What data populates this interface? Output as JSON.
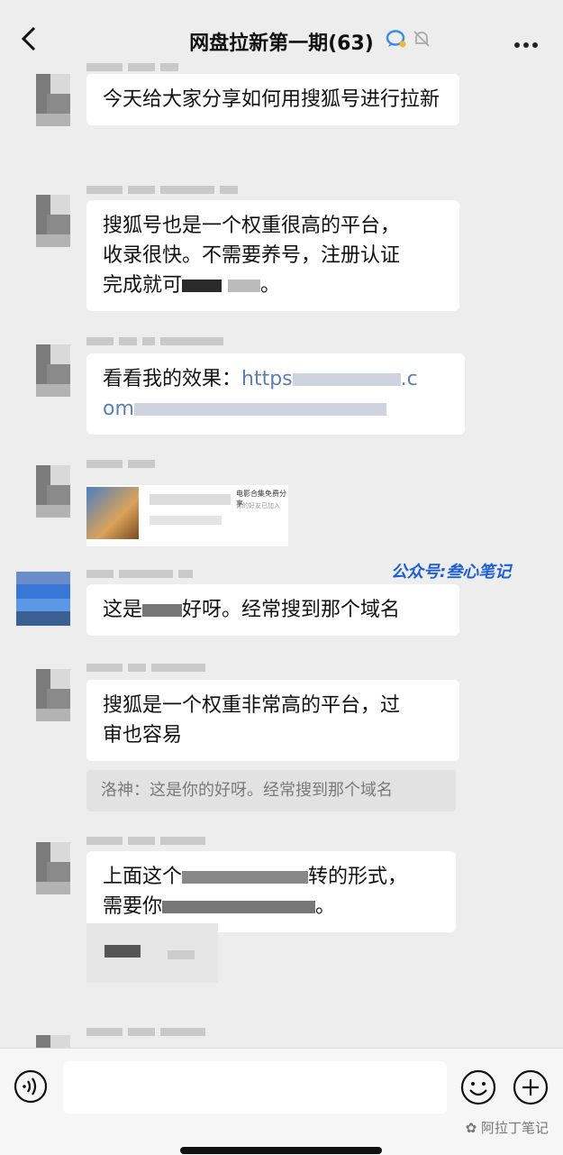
{
  "header": {
    "title": "网盘拉新第一期(63)"
  },
  "messages": [
    {
      "text": "今天给大家分享如何用搜狐号进行拉新"
    },
    {
      "text_line1": "搜狐号也是一个权重很高的平台，",
      "text_line2": "收录很快。不需要养号，注册认证",
      "text_line3_visible": "完成就可",
      "text_line3_end": "。"
    },
    {
      "prefix": "看看我的效果：",
      "link_start": "https",
      "link_mid": ".c",
      "link_line2": "om"
    },
    {
      "card_title": "电影合集免费分享",
      "card_sub": "你的好友已加入"
    },
    {
      "text_prefix": "这是",
      "text_suffix": "好呀。经常搜到那个域名"
    },
    {
      "text_line1": "搜狐是一个权重非常高的平台，过",
      "text_line2": "审也容易",
      "quote": "洛神：这是你的好呀。经常搜到那个域名"
    },
    {
      "text_line1_a": "上面这个",
      "text_line1_b": "转的形式，",
      "text_line2_a": "需要你",
      "text_line2_b": "。"
    }
  ],
  "watermark": "公众号:叁心笔记",
  "footer_mark": "阿拉丁笔记"
}
